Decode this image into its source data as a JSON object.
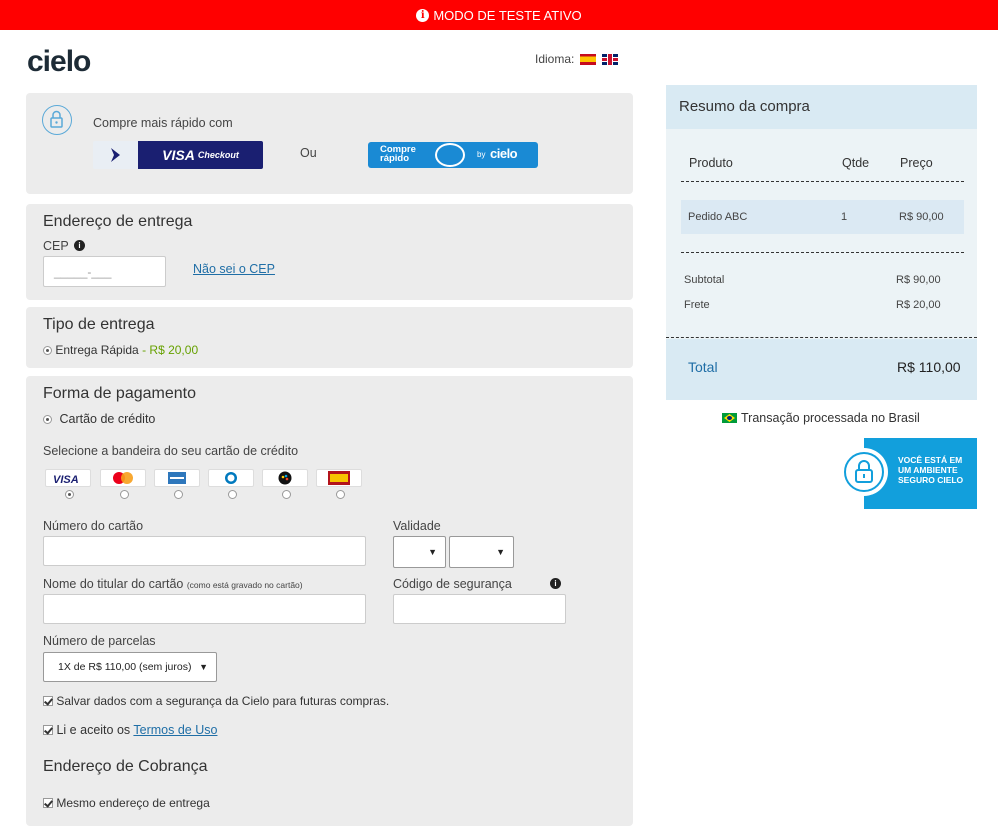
{
  "test_banner": {
    "icon": "info-icon",
    "text": "MODO DE TESTE ATIVO",
    "color": "#ff0000"
  },
  "header": {
    "logo_text": "cielo",
    "language_label": "Idioma:",
    "languages": [
      "Español",
      "English"
    ]
  },
  "quick_buy": {
    "label": "Compre mais rápido com",
    "or_text": "Ou",
    "visa_checkout": {
      "brand": "VISA",
      "suffix": "Checkout"
    },
    "compre_rapido": {
      "line1": "Compre",
      "line2": "rápido",
      "by": "by",
      "brand": "cielo"
    }
  },
  "shipping_address": {
    "title": "Endereço de entrega",
    "cep_label": "CEP",
    "cep_placeholder": "_____-___",
    "unknown_cep_link": "Não sei o CEP"
  },
  "delivery_type": {
    "title": "Tipo de entrega",
    "option_label": "Entrega Rápida",
    "option_price": "- R$ 20,00",
    "price_color": "#66a100"
  },
  "payment": {
    "title": "Forma de pagamento",
    "method": "Cartão de crédito",
    "brand_prompt": "Selecione a bandeira do seu cartão de crédito",
    "brands": [
      "Visa",
      "Mastercard",
      "American Express",
      "Diners Club",
      "Elo",
      "Hipercard"
    ],
    "selected_brand": "Visa",
    "card_number_label": "Número do cartão",
    "expiry_label": "Validade",
    "holder_label": "Nome do titular do cartão",
    "holder_hint": "(como está gravado no cartão)",
    "security_code_label": "Código de segurança",
    "installments_label": "Número de parcelas",
    "installments_value": "1X de R$ 110,00 (sem juros)",
    "save_data_label": "Salvar dados com a segurança da Cielo para futuras compras.",
    "terms_prefix": "Li e aceito os",
    "terms_link": "Termos de Uso"
  },
  "billing": {
    "title": "Endereço de Cobrança",
    "same_address_label": "Mesmo endereço de entrega"
  },
  "summary": {
    "title": "Resumo da compra",
    "col_product": "Produto",
    "col_qty": "Qtde",
    "col_price": "Preço",
    "item": {
      "name": "Pedido ABC",
      "qty": "1",
      "price": "R$ 90,00"
    },
    "subtotal_label": "Subtotal",
    "subtotal_value": "R$ 90,00",
    "shipping_label": "Frete",
    "shipping_value": "R$ 20,00",
    "total_label": "Total",
    "total_value": "R$ 110,00",
    "accent_color": "#1f6ea6"
  },
  "trust": {
    "processed_text": "Transação processada no Brasil",
    "secure_line1": "VOCÊ ESTÁ EM",
    "secure_line2": "UM AMBIENTE",
    "secure_line3": "SEGURO CIELO"
  }
}
